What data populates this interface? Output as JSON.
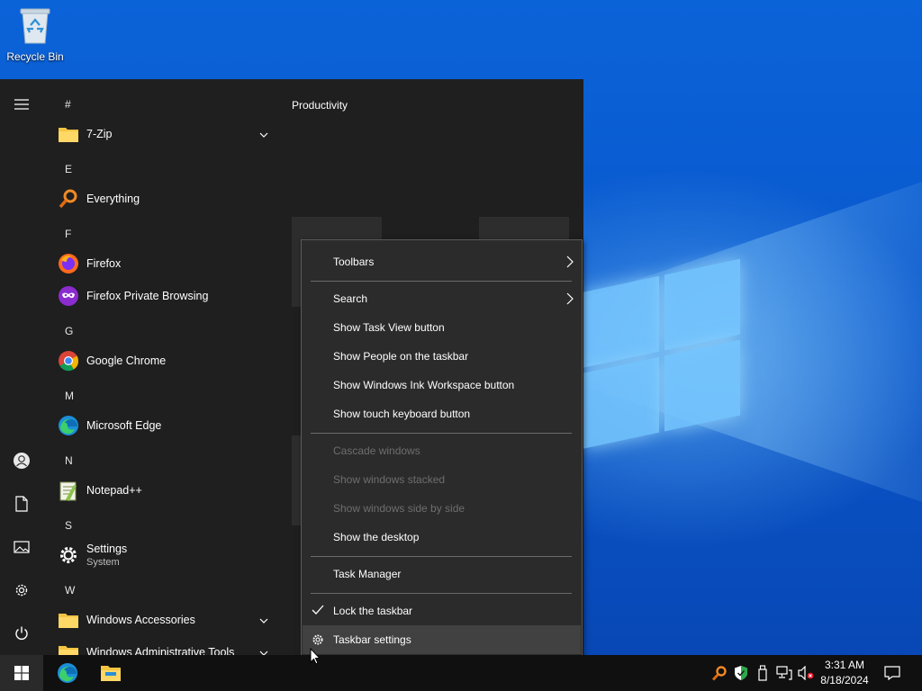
{
  "desktop": {
    "recycle_bin_label": "Recycle Bin"
  },
  "start_menu": {
    "groups": [
      {
        "letter": "#",
        "apps": [
          {
            "name": "7-Zip",
            "subtitle": "",
            "icon": "folder-icon",
            "expandable": true
          }
        ]
      },
      {
        "letter": "E",
        "apps": [
          {
            "name": "Everything",
            "subtitle": "",
            "icon": "magnifier-icon",
            "expandable": false
          }
        ]
      },
      {
        "letter": "F",
        "apps": [
          {
            "name": "Firefox",
            "subtitle": "",
            "icon": "firefox-icon",
            "expandable": false
          },
          {
            "name": "Firefox Private Browsing",
            "subtitle": "",
            "icon": "firefox-private-icon",
            "expandable": false
          }
        ]
      },
      {
        "letter": "G",
        "apps": [
          {
            "name": "Google Chrome",
            "subtitle": "",
            "icon": "chrome-icon",
            "expandable": false
          }
        ]
      },
      {
        "letter": "M",
        "apps": [
          {
            "name": "Microsoft Edge",
            "subtitle": "",
            "icon": "edge-icon",
            "expandable": false
          }
        ]
      },
      {
        "letter": "N",
        "apps": [
          {
            "name": "Notepad++",
            "subtitle": "",
            "icon": "notepadpp-icon",
            "expandable": false
          }
        ]
      },
      {
        "letter": "S",
        "apps": [
          {
            "name": "Settings",
            "subtitle": "System",
            "icon": "gear-icon",
            "expandable": false
          }
        ]
      },
      {
        "letter": "W",
        "apps": [
          {
            "name": "Windows Accessories",
            "subtitle": "",
            "icon": "folder-icon",
            "expandable": true
          },
          {
            "name": "Windows Administrative Tools",
            "subtitle": "",
            "icon": "folder-icon",
            "expandable": true
          }
        ]
      }
    ],
    "tiles_group_title": "Productivity",
    "rail_icons": [
      "hamburger-icon",
      "user-icon",
      "document-icon",
      "pictures-icon",
      "gear-icon",
      "power-icon"
    ]
  },
  "context_menu": {
    "items": [
      {
        "label": "Toolbars",
        "submenu": true,
        "enabled": true
      },
      {
        "label": "Search",
        "submenu": true,
        "enabled": true
      },
      {
        "label": "Show Task View button",
        "enabled": true
      },
      {
        "label": "Show People on the taskbar",
        "enabled": true
      },
      {
        "label": "Show Windows Ink Workspace button",
        "enabled": true
      },
      {
        "label": "Show touch keyboard button",
        "enabled": true
      },
      {
        "label": "Cascade windows",
        "enabled": false
      },
      {
        "label": "Show windows stacked",
        "enabled": false
      },
      {
        "label": "Show windows side by side",
        "enabled": false
      },
      {
        "label": "Show the desktop",
        "enabled": true
      },
      {
        "label": "Task Manager",
        "enabled": true
      },
      {
        "label": "Lock the taskbar",
        "enabled": true,
        "checked": true
      },
      {
        "label": "Taskbar settings",
        "enabled": true,
        "icon": "gear-icon",
        "highlighted": true
      }
    ]
  },
  "taskbar": {
    "pinned": [
      "windows-start-icon",
      "edge-icon",
      "file-explorer-icon"
    ],
    "tray": [
      "everything-tray-icon",
      "shield-icon",
      "usb-device-icon",
      "network-icon",
      "volume-muted-icon"
    ],
    "clock_time": "3:31 AM",
    "clock_date": "8/18/2024",
    "notifications_icon": "action-center-icon"
  },
  "colors": {
    "start_bg": "#1f1f1f",
    "menu_bg": "#2b2b2b",
    "taskbar_bg": "#101010",
    "wallpaper_blue": "#0a57cc",
    "folder_yellow": "#f4c542"
  }
}
